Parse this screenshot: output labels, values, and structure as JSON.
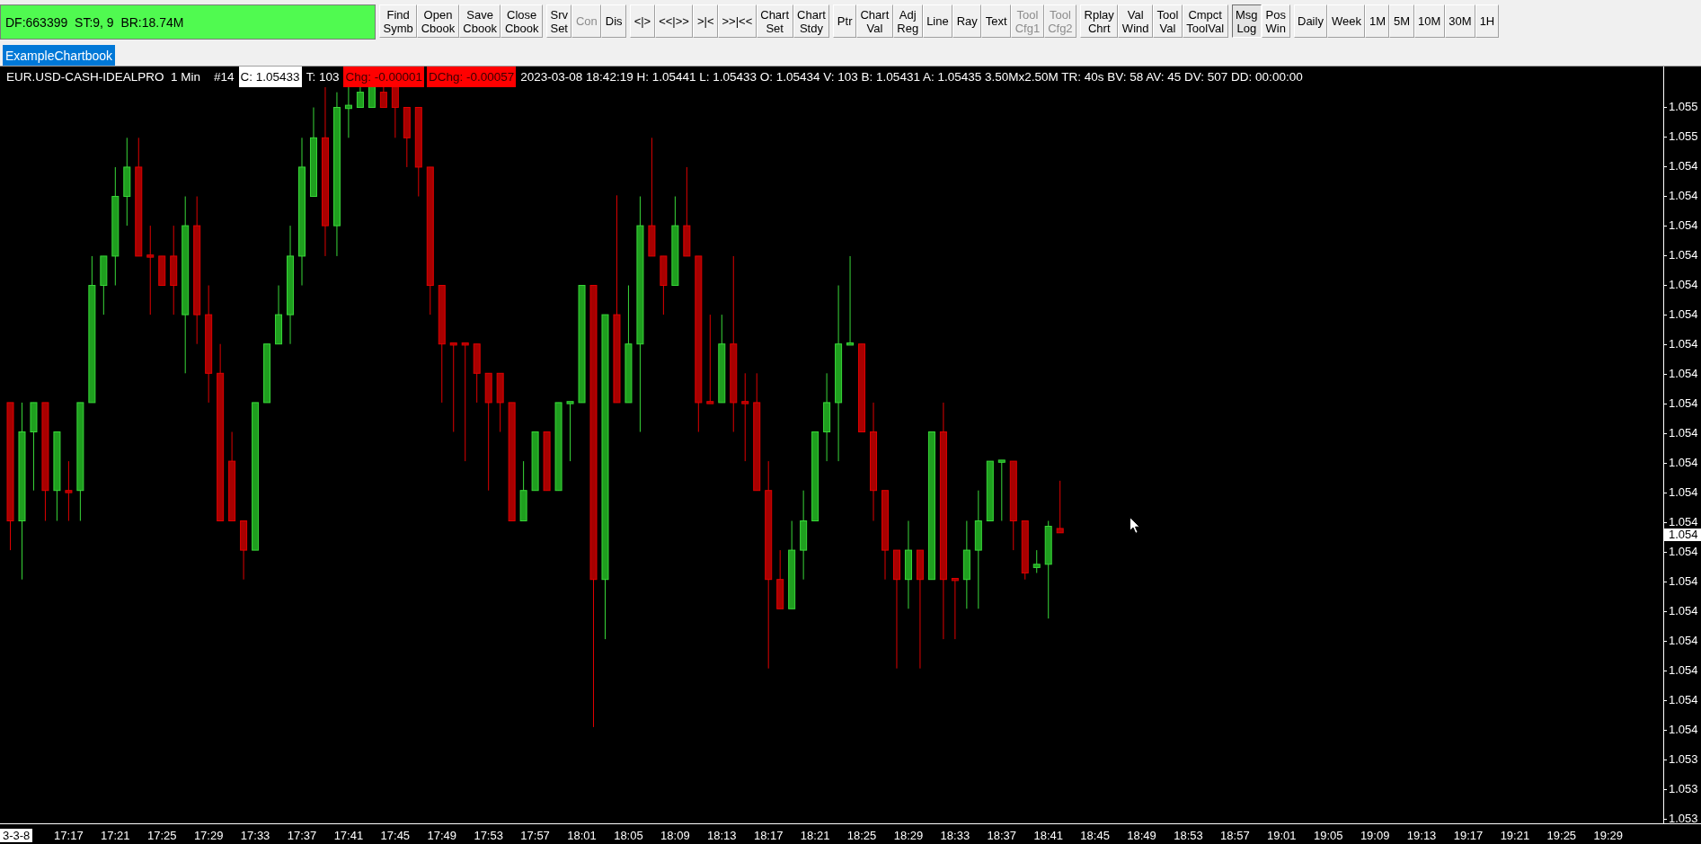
{
  "status_box": {
    "text": "DF:663399  ST:9, 9  BR:18.74M"
  },
  "toolbar": {
    "groups": [
      [
        {
          "label": "Find Symb",
          "disabled": false,
          "pressed": false
        },
        {
          "label": "Open Cbook",
          "disabled": false,
          "pressed": false
        },
        {
          "label": "Save Cbook",
          "disabled": false,
          "pressed": false
        },
        {
          "label": "Close Cbook",
          "disabled": false,
          "pressed": false
        }
      ],
      [
        {
          "label": "Srv Set",
          "disabled": false,
          "pressed": false
        },
        {
          "label": "Con",
          "disabled": true,
          "pressed": false
        },
        {
          "label": "Dis",
          "disabled": false,
          "pressed": false
        }
      ],
      [
        {
          "label": "<|>",
          "disabled": false,
          "pressed": false
        },
        {
          "label": "<<|>>",
          "disabled": false,
          "pressed": false
        },
        {
          "label": ">|<",
          "disabled": false,
          "pressed": false
        },
        {
          "label": ">>|<<",
          "disabled": false,
          "pressed": false
        },
        {
          "label": "Chart Set",
          "disabled": false,
          "pressed": false
        },
        {
          "label": "Chart Stdy",
          "disabled": false,
          "pressed": false
        }
      ],
      [
        {
          "label": "Ptr",
          "disabled": false,
          "pressed": false
        },
        {
          "label": "Chart Val",
          "disabled": false,
          "pressed": false
        },
        {
          "label": "Adj Reg",
          "disabled": false,
          "pressed": false
        },
        {
          "label": "Line",
          "disabled": false,
          "pressed": false
        },
        {
          "label": "Ray",
          "disabled": false,
          "pressed": false
        },
        {
          "label": "Text",
          "disabled": false,
          "pressed": false
        },
        {
          "label": "Tool Cfg1",
          "disabled": true,
          "pressed": false
        },
        {
          "label": "Tool Cfg2",
          "disabled": true,
          "pressed": false
        }
      ],
      [
        {
          "label": "Rplay Chrt",
          "disabled": false,
          "pressed": false
        },
        {
          "label": "Val Wind",
          "disabled": false,
          "pressed": false
        },
        {
          "label": "Tool Val",
          "disabled": false,
          "pressed": false
        },
        {
          "label": "Cmpct ToolVal",
          "disabled": false,
          "pressed": false
        }
      ],
      [
        {
          "label": "Msg Log",
          "disabled": false,
          "pressed": true
        },
        {
          "label": "Pos Win",
          "disabled": false,
          "pressed": false
        }
      ],
      [
        {
          "label": "Daily",
          "disabled": false,
          "pressed": false
        },
        {
          "label": "Week",
          "disabled": false,
          "pressed": false
        },
        {
          "label": "1M",
          "disabled": false,
          "pressed": false
        },
        {
          "label": "5M",
          "disabled": false,
          "pressed": false
        },
        {
          "label": "10M",
          "disabled": false,
          "pressed": false
        },
        {
          "label": "30M",
          "disabled": false,
          "pressed": false
        },
        {
          "label": "1H",
          "disabled": false,
          "pressed": false
        }
      ]
    ]
  },
  "chartbook_tabs": [
    {
      "label": "ExampleChartbook",
      "selected": true
    }
  ],
  "chart": {
    "info_line": [
      {
        "text": "EUR.USD-CASH-IDEALPRO  1 Min    #14",
        "kind": "plain"
      },
      {
        "text": "C: 1.05433",
        "kind": "highlight"
      },
      {
        "text": "T: 103",
        "kind": "plain"
      },
      {
        "text": "Chg: -0.00001",
        "kind": "negative"
      },
      {
        "text": "DChg: -0.00057",
        "kind": "negative"
      },
      {
        "text": "2023-03-08 18:42:19 H: 1.05441 L: 1.05433 O: 1.05434 V: 103 B: 1.05431 A: 1.05435 3.50Mx2.50M TR: 40s BV: 58 AV: 45 DV: 507 DD: 00:00:00",
        "kind": "plain"
      }
    ],
    "price_axis": {
      "labels": [
        "1.055",
        "1.055",
        "1.054",
        "1.054",
        "1.054",
        "1.054",
        "1.054",
        "1.054",
        "1.054",
        "1.054",
        "1.054",
        "1.054",
        "1.054",
        "1.054",
        "1.054",
        "1.054",
        "1.054",
        "1.054",
        "1.054",
        "1.054",
        "1.054",
        "1.054",
        "1.053",
        "1.053",
        "1.053"
      ],
      "current_price": "1.054"
    },
    "time_axis": {
      "date_label": "3-3-8",
      "labels": [
        "17:17",
        "17:21",
        "17:25",
        "17:29",
        "17:33",
        "17:37",
        "17:41",
        "17:45",
        "17:49",
        "17:53",
        "17:57",
        "18:01",
        "18:05",
        "18:09",
        "18:13",
        "18:17",
        "18:21",
        "18:25",
        "18:29",
        "18:33",
        "18:37",
        "18:41",
        "18:45",
        "18:49",
        "18:53",
        "18:57",
        "19:01",
        "19:05",
        "19:09",
        "19:13",
        "19:17",
        "19:21",
        "19:25",
        "19:29"
      ]
    }
  }
}
